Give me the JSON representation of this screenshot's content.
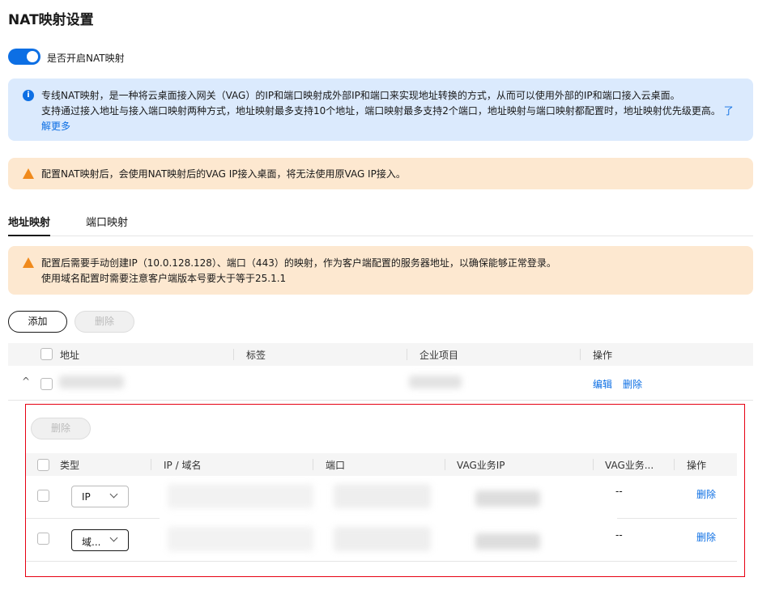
{
  "title": "NAT映射设置",
  "toggle": {
    "label": "是否开启NAT映射",
    "on": true
  },
  "info": {
    "line1": "专线NAT映射，是一种将云桌面接入网关（VAG）的IP和端口映射成外部IP和端口来实现地址转换的方式，从而可以使用外部的IP和端口接入云桌面。",
    "line2": "支持通过接入地址与接入端口映射两种方式，地址映射最多支持10个地址，端口映射最多支持2个端口，地址映射与端口映射都配置时，地址映射优先级更高。",
    "link": "了解更多"
  },
  "warning": "配置NAT映射后，会使用NAT映射后的VAG IP接入桌面，将无法使用原VAG IP接入。",
  "tabs": [
    "地址映射",
    "端口映射"
  ],
  "tab_warning": {
    "line1": "配置后需要手动创建IP（10.0.128.128）、端口（443）的映射，作为客户端配置的服务器地址，以确保能够正常登录。",
    "line2": "使用域名配置时需要注意客户端版本号要大于等于25.1.1"
  },
  "buttons": {
    "add": "添加",
    "delete": "删除"
  },
  "table": {
    "headers": [
      "地址",
      "标签",
      "企业项目",
      "操作"
    ],
    "row": {
      "actions": [
        "编辑",
        "删除"
      ]
    }
  },
  "sub": {
    "delete": "删除",
    "headers": [
      "类型",
      "IP / 域名",
      "端口",
      "VAG业务IP",
      "VAG业务...",
      "操作"
    ],
    "rows": [
      {
        "type": "IP",
        "vag2": "--",
        "action": "删除"
      },
      {
        "type": "域...",
        "vag2": "--",
        "action": "删除"
      }
    ]
  }
}
